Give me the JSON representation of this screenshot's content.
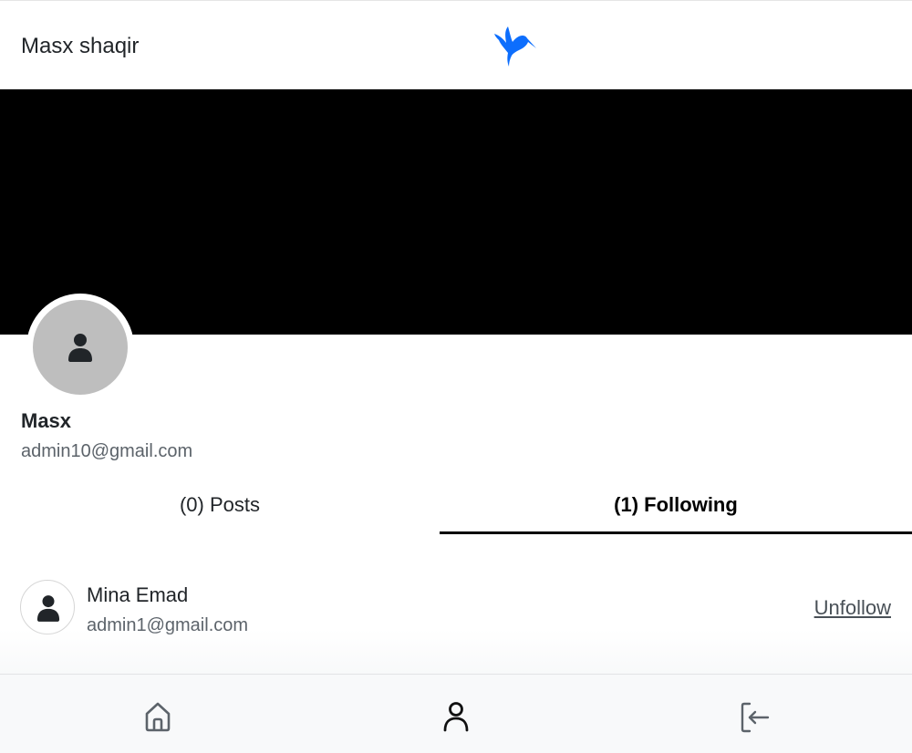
{
  "header": {
    "title": "Masx shaqir",
    "logo_icon": "hummingbird-icon",
    "brand_color": "#0d6efd"
  },
  "profile": {
    "cover_color": "#000000",
    "avatar_icon": "person-icon",
    "name": "Masx",
    "email": "admin10@gmail.com"
  },
  "tabs": [
    {
      "label": "(0) Posts",
      "active": false
    },
    {
      "label": "(1) Following",
      "active": true
    }
  ],
  "following": [
    {
      "name": "Mina Emad",
      "email": "admin1@gmail.com",
      "avatar_icon": "person-icon",
      "action_label": "Unfollow"
    }
  ],
  "bottom_nav": {
    "items": [
      {
        "icon": "home-icon"
      },
      {
        "icon": "person-icon",
        "active": true
      },
      {
        "icon": "logout-icon"
      }
    ]
  }
}
